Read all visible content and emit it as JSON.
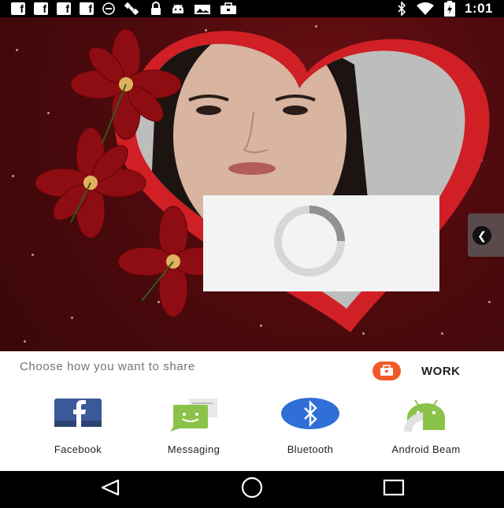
{
  "status_bar": {
    "notification_icons": [
      "facebook-icon",
      "facebook-icon",
      "facebook-icon",
      "facebook-icon",
      "info-icon",
      "satellite-icon",
      "lock-icon",
      "android-icon",
      "photo-icon",
      "briefcase-icon"
    ],
    "facebook_glyph": "f",
    "system_icons": [
      "bluetooth-icon",
      "wifi-icon",
      "battery-charging-icon"
    ],
    "time": "1:01"
  },
  "content": {
    "background_color": "#4e0a0d",
    "heart_color": "#d11f26",
    "loading_indicator": "spinner"
  },
  "side_tab": {
    "icon": "chevron-left-icon",
    "glyph": "❮"
  },
  "share_sheet": {
    "title": "Choose how you want to share",
    "work_label": "WORK",
    "targets": [
      {
        "label": "Facebook",
        "icon": "facebook-icon",
        "color": "#3b5998"
      },
      {
        "label": "Messaging",
        "icon": "messaging-icon",
        "color": "#8bc34a"
      },
      {
        "label": "Bluetooth",
        "icon": "bluetooth-icon",
        "color": "#2f6fd6"
      },
      {
        "label": "Android Beam",
        "icon": "android-beam-icon",
        "color": "#8bc34a"
      }
    ]
  },
  "nav_bar": {
    "buttons": [
      "back-icon",
      "home-icon",
      "recents-icon"
    ]
  }
}
